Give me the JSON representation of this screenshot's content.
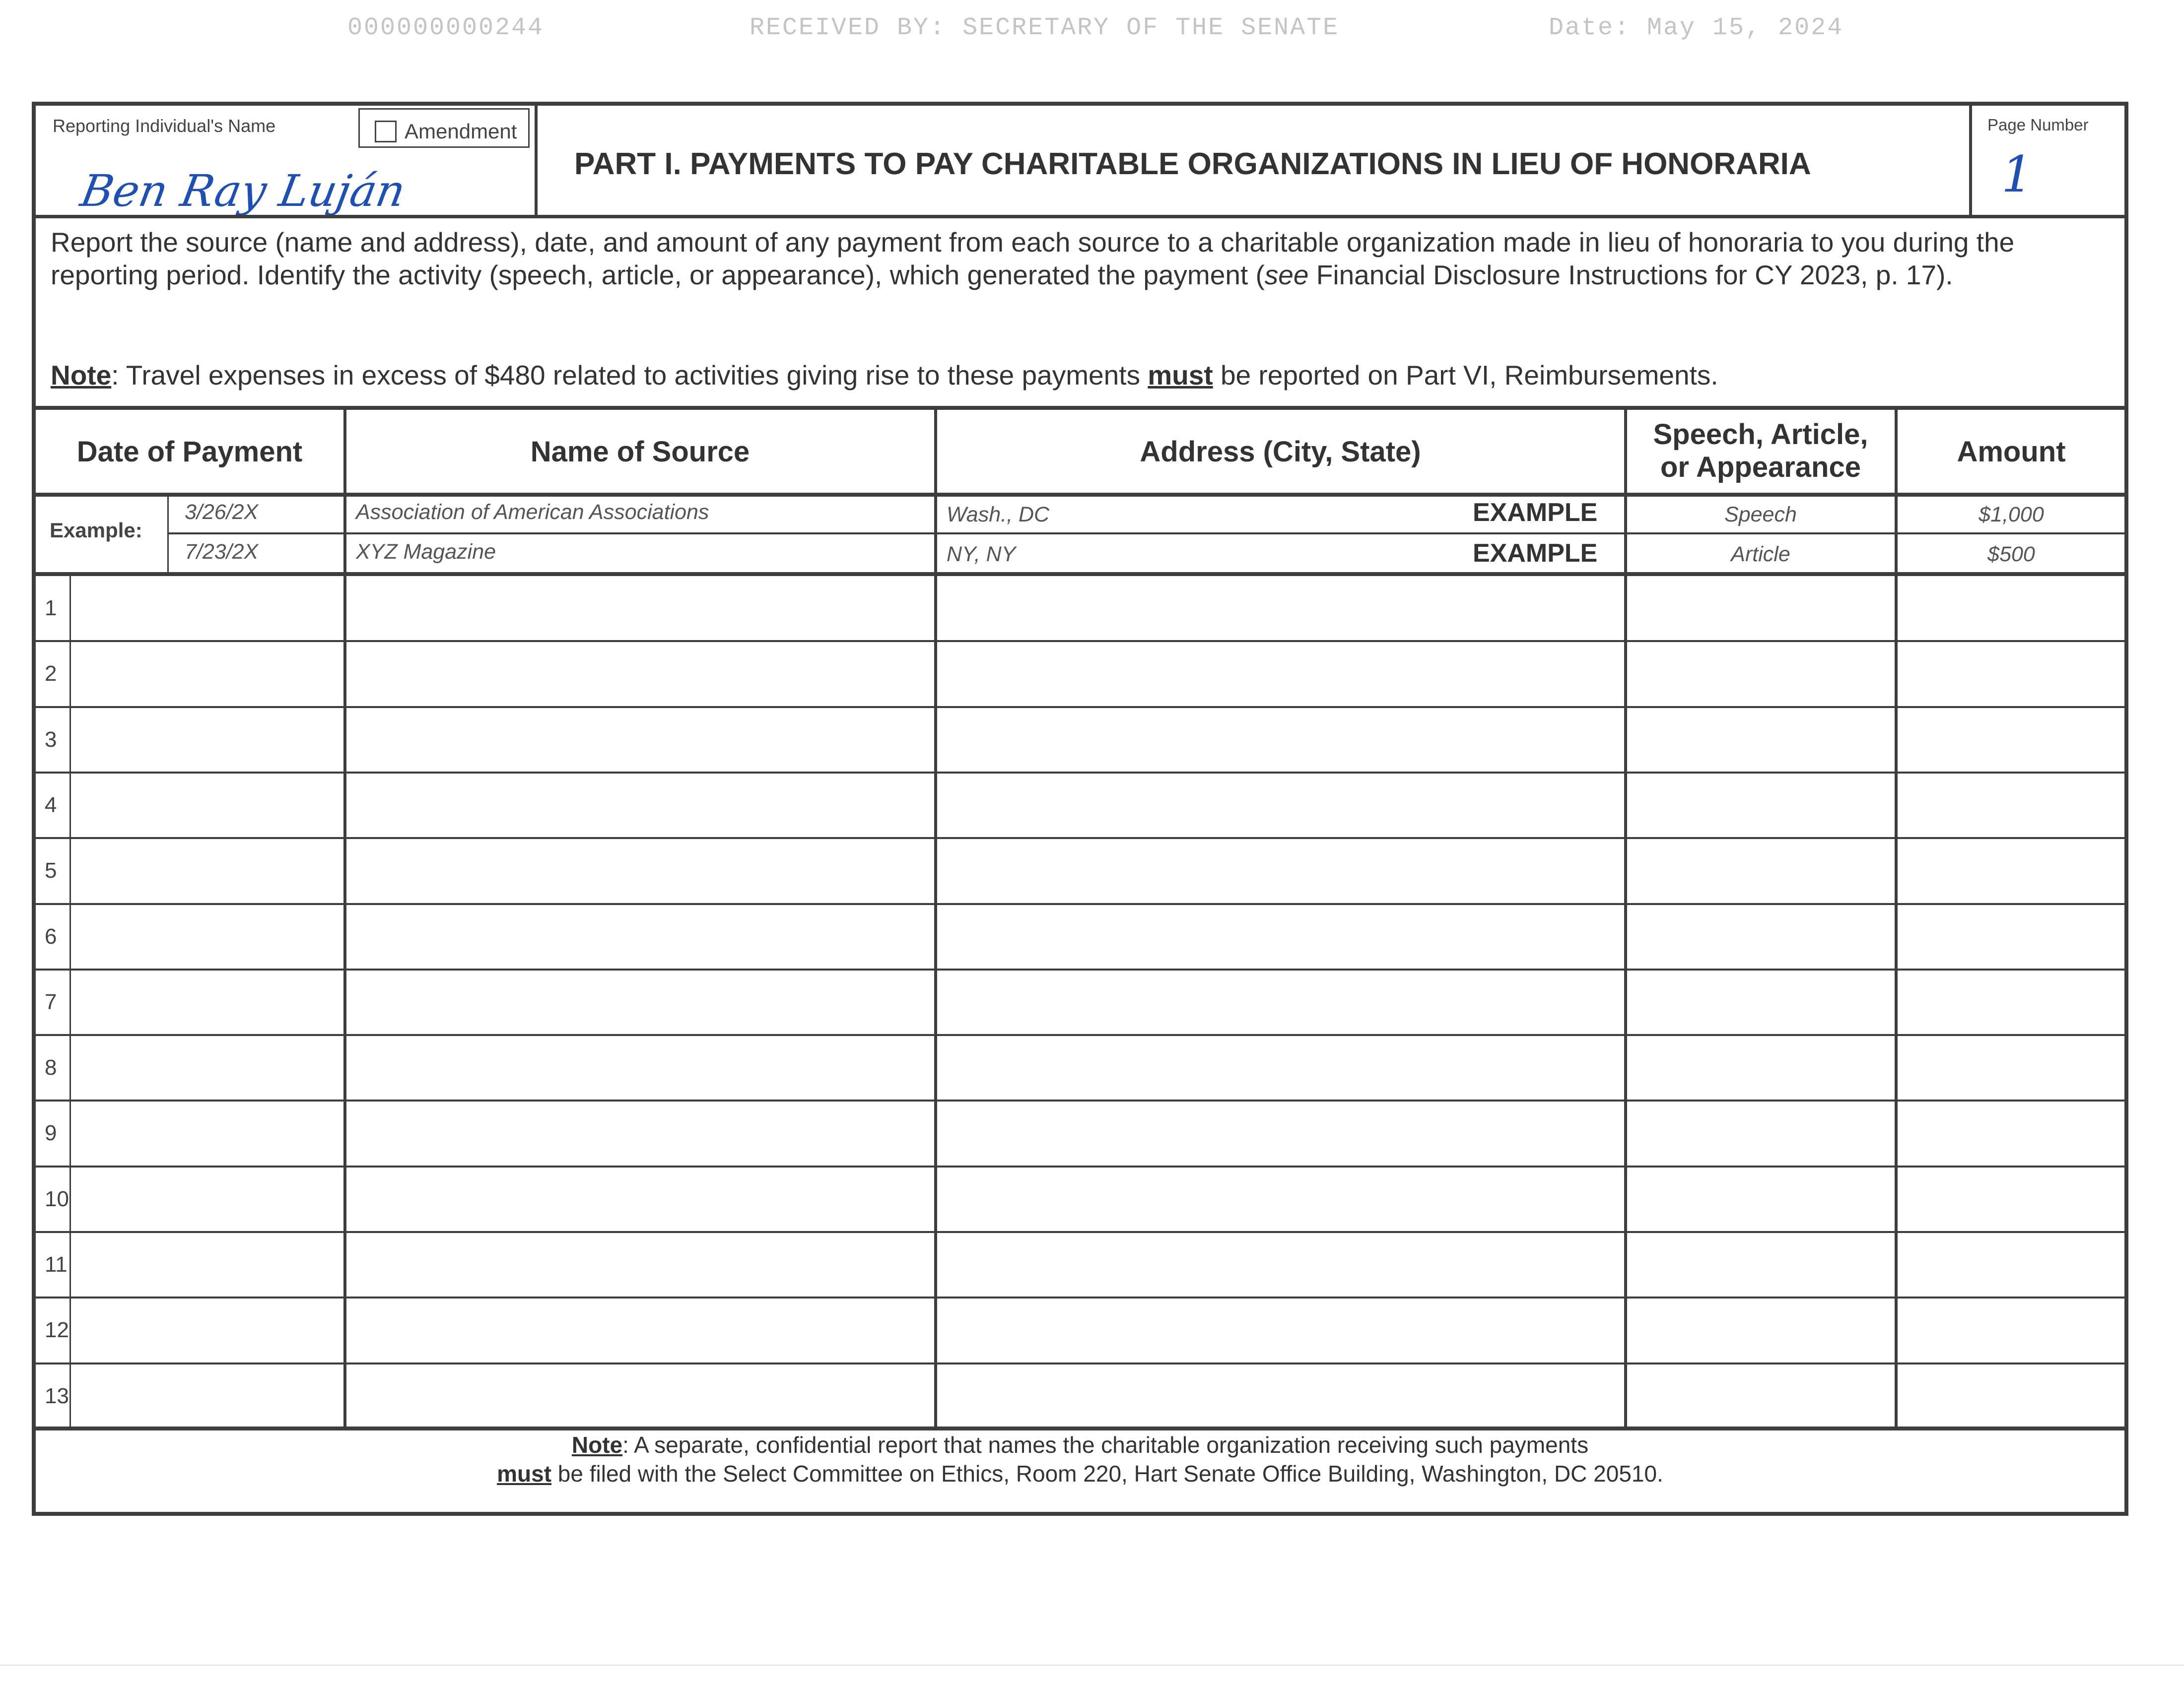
{
  "stamp": {
    "doc_id": "000000000244",
    "received": "RECEIVED BY: SECRETARY OF THE SENATE",
    "date": "Date: May 15, 2024"
  },
  "header": {
    "name_label": "Reporting Individual's Name",
    "amendment_label": "Amendment",
    "signature_text": "Ben Ray Luján",
    "title": "PART I.   PAYMENTS TO PAY CHARITABLE ORGANIZATIONS IN LIEU OF HONORARIA",
    "page_number_label": "Page Number",
    "page_number": "1"
  },
  "instructions": {
    "text_before_see": "Report the source (name and address), date, and amount of any payment from each source to a charitable organization made in lieu of honoraria to you during the reporting period.  Identify the activity (speech, article, or appearance), which generated the payment (",
    "see": "see",
    "text_after_see": " Financial Disclosure Instructions for CY 2023, p. 17).",
    "note_label": "Note",
    "note_before_must": ": Travel expenses in excess of $480 related to activities giving rise to these payments ",
    "note_must": "must",
    "note_after_must": " be reported on Part VI, Reimbursements."
  },
  "table": {
    "headers": {
      "date": "Date of Payment",
      "source": "Name of Source",
      "address": "Address (City, State)",
      "activity_line1": "Speech, Article,",
      "activity_line2": "or Appearance",
      "amount": "Amount"
    },
    "example_label": "Example:",
    "examples": [
      {
        "date": "3/26/2X",
        "source": "Association of American Associations",
        "address": "Wash., DC",
        "tag": "EXAMPLE",
        "activity": "Speech",
        "amount": "$1,000"
      },
      {
        "date": "7/23/2X",
        "source": "XYZ Magazine",
        "address": "NY, NY",
        "tag": "EXAMPLE",
        "activity": "Article",
        "amount": "$500"
      }
    ],
    "row_numbers": [
      "1",
      "2",
      "3",
      "4",
      "5",
      "6",
      "7",
      "8",
      "9",
      "10",
      "11",
      "12",
      "13"
    ]
  },
  "footer": {
    "note_label": "Note",
    "line1_rest": ": A separate, confidential report that names the charitable organization receiving such payments",
    "must": "must",
    "line2_rest": " be filed with the Select Committee on Ethics, Room 220, Hart Senate Office Building, Washington, DC 20510."
  }
}
